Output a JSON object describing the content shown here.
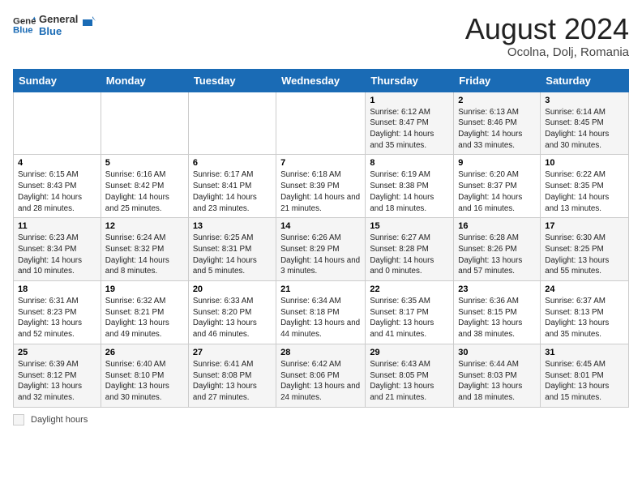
{
  "header": {
    "logo_line1": "General",
    "logo_line2": "Blue",
    "month_year": "August 2024",
    "location": "Ocolna, Dolj, Romania"
  },
  "days_of_week": [
    "Sunday",
    "Monday",
    "Tuesday",
    "Wednesday",
    "Thursday",
    "Friday",
    "Saturday"
  ],
  "weeks": [
    [
      {
        "day": "",
        "detail": ""
      },
      {
        "day": "",
        "detail": ""
      },
      {
        "day": "",
        "detail": ""
      },
      {
        "day": "",
        "detail": ""
      },
      {
        "day": "1",
        "detail": "Sunrise: 6:12 AM\nSunset: 8:47 PM\nDaylight: 14 hours and 35 minutes."
      },
      {
        "day": "2",
        "detail": "Sunrise: 6:13 AM\nSunset: 8:46 PM\nDaylight: 14 hours and 33 minutes."
      },
      {
        "day": "3",
        "detail": "Sunrise: 6:14 AM\nSunset: 8:45 PM\nDaylight: 14 hours and 30 minutes."
      }
    ],
    [
      {
        "day": "4",
        "detail": "Sunrise: 6:15 AM\nSunset: 8:43 PM\nDaylight: 14 hours and 28 minutes."
      },
      {
        "day": "5",
        "detail": "Sunrise: 6:16 AM\nSunset: 8:42 PM\nDaylight: 14 hours and 25 minutes."
      },
      {
        "day": "6",
        "detail": "Sunrise: 6:17 AM\nSunset: 8:41 PM\nDaylight: 14 hours and 23 minutes."
      },
      {
        "day": "7",
        "detail": "Sunrise: 6:18 AM\nSunset: 8:39 PM\nDaylight: 14 hours and 21 minutes."
      },
      {
        "day": "8",
        "detail": "Sunrise: 6:19 AM\nSunset: 8:38 PM\nDaylight: 14 hours and 18 minutes."
      },
      {
        "day": "9",
        "detail": "Sunrise: 6:20 AM\nSunset: 8:37 PM\nDaylight: 14 hours and 16 minutes."
      },
      {
        "day": "10",
        "detail": "Sunrise: 6:22 AM\nSunset: 8:35 PM\nDaylight: 14 hours and 13 minutes."
      }
    ],
    [
      {
        "day": "11",
        "detail": "Sunrise: 6:23 AM\nSunset: 8:34 PM\nDaylight: 14 hours and 10 minutes."
      },
      {
        "day": "12",
        "detail": "Sunrise: 6:24 AM\nSunset: 8:32 PM\nDaylight: 14 hours and 8 minutes."
      },
      {
        "day": "13",
        "detail": "Sunrise: 6:25 AM\nSunset: 8:31 PM\nDaylight: 14 hours and 5 minutes."
      },
      {
        "day": "14",
        "detail": "Sunrise: 6:26 AM\nSunset: 8:29 PM\nDaylight: 14 hours and 3 minutes."
      },
      {
        "day": "15",
        "detail": "Sunrise: 6:27 AM\nSunset: 8:28 PM\nDaylight: 14 hours and 0 minutes."
      },
      {
        "day": "16",
        "detail": "Sunrise: 6:28 AM\nSunset: 8:26 PM\nDaylight: 13 hours and 57 minutes."
      },
      {
        "day": "17",
        "detail": "Sunrise: 6:30 AM\nSunset: 8:25 PM\nDaylight: 13 hours and 55 minutes."
      }
    ],
    [
      {
        "day": "18",
        "detail": "Sunrise: 6:31 AM\nSunset: 8:23 PM\nDaylight: 13 hours and 52 minutes."
      },
      {
        "day": "19",
        "detail": "Sunrise: 6:32 AM\nSunset: 8:21 PM\nDaylight: 13 hours and 49 minutes."
      },
      {
        "day": "20",
        "detail": "Sunrise: 6:33 AM\nSunset: 8:20 PM\nDaylight: 13 hours and 46 minutes."
      },
      {
        "day": "21",
        "detail": "Sunrise: 6:34 AM\nSunset: 8:18 PM\nDaylight: 13 hours and 44 minutes."
      },
      {
        "day": "22",
        "detail": "Sunrise: 6:35 AM\nSunset: 8:17 PM\nDaylight: 13 hours and 41 minutes."
      },
      {
        "day": "23",
        "detail": "Sunrise: 6:36 AM\nSunset: 8:15 PM\nDaylight: 13 hours and 38 minutes."
      },
      {
        "day": "24",
        "detail": "Sunrise: 6:37 AM\nSunset: 8:13 PM\nDaylight: 13 hours and 35 minutes."
      }
    ],
    [
      {
        "day": "25",
        "detail": "Sunrise: 6:39 AM\nSunset: 8:12 PM\nDaylight: 13 hours and 32 minutes."
      },
      {
        "day": "26",
        "detail": "Sunrise: 6:40 AM\nSunset: 8:10 PM\nDaylight: 13 hours and 30 minutes."
      },
      {
        "day": "27",
        "detail": "Sunrise: 6:41 AM\nSunset: 8:08 PM\nDaylight: 13 hours and 27 minutes."
      },
      {
        "day": "28",
        "detail": "Sunrise: 6:42 AM\nSunset: 8:06 PM\nDaylight: 13 hours and 24 minutes."
      },
      {
        "day": "29",
        "detail": "Sunrise: 6:43 AM\nSunset: 8:05 PM\nDaylight: 13 hours and 21 minutes."
      },
      {
        "day": "30",
        "detail": "Sunrise: 6:44 AM\nSunset: 8:03 PM\nDaylight: 13 hours and 18 minutes."
      },
      {
        "day": "31",
        "detail": "Sunrise: 6:45 AM\nSunset: 8:01 PM\nDaylight: 13 hours and 15 minutes."
      }
    ]
  ],
  "footer": {
    "daylight_label": "Daylight hours"
  }
}
